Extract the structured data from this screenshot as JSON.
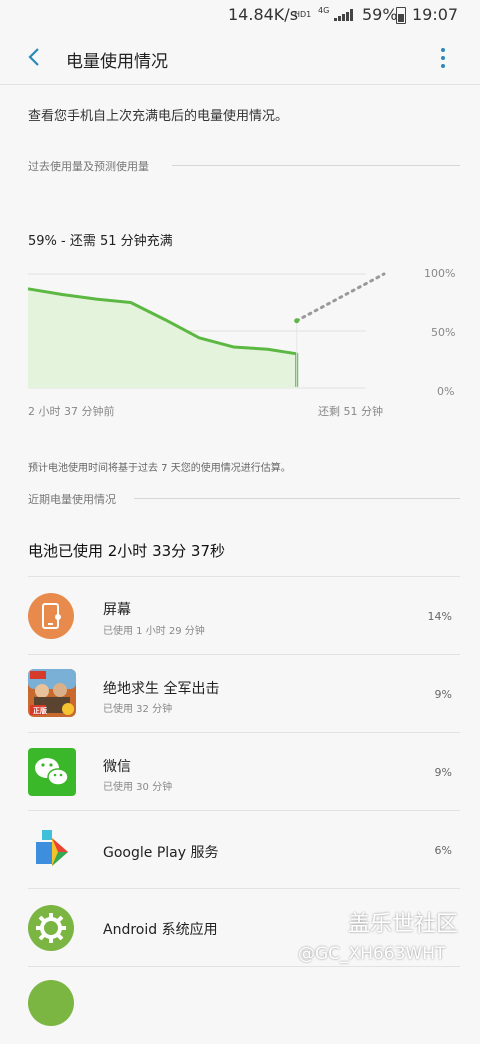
{
  "status_bar": {
    "speed": "14.84K/s",
    "hd": "HD1",
    "network": "4G",
    "battery_pct": "59%",
    "time": "19:07"
  },
  "app_bar": {
    "title": "电量使用情况"
  },
  "intro_text": "查看您手机自上次充满电后的电量使用情况。",
  "past_section": {
    "header": "过去使用量及预测使用量",
    "status_line": "59% - 还需 51 分钟充满"
  },
  "chart_data": {
    "type": "line",
    "ylim": [
      0,
      100
    ],
    "yticks": [
      "100%",
      "50%",
      "0%"
    ],
    "x_start_label": "2 小时 37 分钟前",
    "x_end_label": "还剩 51 分钟",
    "past_series": {
      "x": [
        0,
        20,
        40,
        60,
        80,
        100,
        120,
        140,
        157
      ],
      "y": [
        87,
        82,
        78,
        75,
        60,
        44,
        36,
        34,
        30,
        1
      ]
    },
    "predicted_series": {
      "x": [
        157,
        208
      ],
      "y": [
        59,
        100
      ]
    },
    "x_total_minutes": 208,
    "colors": {
      "line": "#5cb842",
      "fill": "#e3f3dc",
      "predicted": "#9a9a9a"
    }
  },
  "predict_note": "预计电池使用时间将基于过去 7 天您的使用情况进行估算。",
  "recent_section": {
    "header": "近期电量使用情况",
    "total_used": "电池已使用 2小时 33分 37秒"
  },
  "apps": [
    {
      "name": "屏幕",
      "sub": "已使用 1 小时 29 分钟",
      "pct": "14%",
      "icon": "screen-icon"
    },
    {
      "name": "绝地求生 全军出击",
      "sub": "已使用 32 分钟",
      "pct": "9%",
      "icon": "pubg-icon",
      "icon_badge": "正版"
    },
    {
      "name": "微信",
      "sub": "已使用 30 分钟",
      "pct": "9%",
      "icon": "wechat-icon"
    },
    {
      "name": "Google Play 服务",
      "sub": "",
      "pct": "6%",
      "icon": "google-play-services-icon"
    },
    {
      "name": "Android 系统应用",
      "sub": "",
      "pct": "",
      "icon": "android-gear-icon"
    }
  ],
  "watermark": {
    "brand": "盖乐世社区",
    "user": "@GC_XH663WHT"
  }
}
